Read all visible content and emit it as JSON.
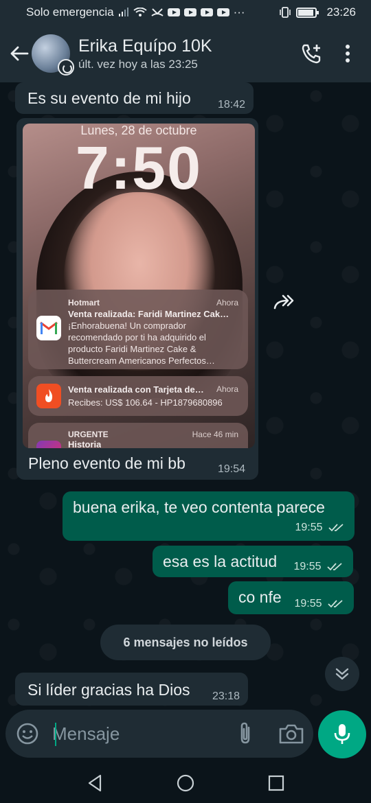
{
  "status_bar": {
    "carrier": "Solo emergencia",
    "time": "23:26"
  },
  "header": {
    "contact_name": "Erika Equípo 10K",
    "last_seen": "últ. vez hoy a las 23:25",
    "avatar_icon": "avatar-photo",
    "add_call_icon": "add-call-icon",
    "menu_icon": "more-vertical-icon"
  },
  "messages": [
    {
      "direction": "in",
      "text": "Es su evento de mi hijo",
      "time": "18:42"
    },
    {
      "direction": "in",
      "type": "image",
      "caption": "Pleno evento de mi bb",
      "time": "19:54",
      "image_content": {
        "lock_date": "Lunes, 28 de octubre",
        "lock_time": "7:50",
        "notifications": [
          {
            "app": "Hotmart",
            "when": "Ahora",
            "title": "Venta realizada: Faridi Martinez Cak…",
            "body": [
              "¡Enhorabuena! Un comprador",
              "recomendado por ti ha adquirido el",
              "producto Faridi Martinez Cake &",
              "Buttercream Americanos Perfectos…"
            ]
          },
          {
            "app": "",
            "when": "Ahora",
            "title": "Venta realizada con Tarjeta de…",
            "body": [
              "Recibes: US$ 106.64 - HP1879680896"
            ]
          },
          {
            "app": "URGENTE",
            "when": "Hace 46 min",
            "title": "Historia",
            "body": []
          }
        ]
      }
    },
    {
      "direction": "out",
      "text": "buena erika, te veo contenta parece",
      "time": "19:55"
    },
    {
      "direction": "out",
      "text": "esa es la actitud",
      "time": "19:55"
    },
    {
      "direction": "out",
      "text": "co nfe",
      "time": "19:55"
    },
    {
      "direction": "in",
      "text": "Si líder gracias ha Dios",
      "time": "23:18"
    }
  ],
  "unread_banner": "6 mensajes no leídos",
  "composer": {
    "placeholder": "Mensaje"
  },
  "colors": {
    "background": "#0b141a",
    "bar": "#1f2c34",
    "incoming_bubble": "#1f2c34",
    "outgoing_bubble": "#005c4b",
    "accent": "#00a884",
    "read_ticks": "#cde3dc"
  }
}
